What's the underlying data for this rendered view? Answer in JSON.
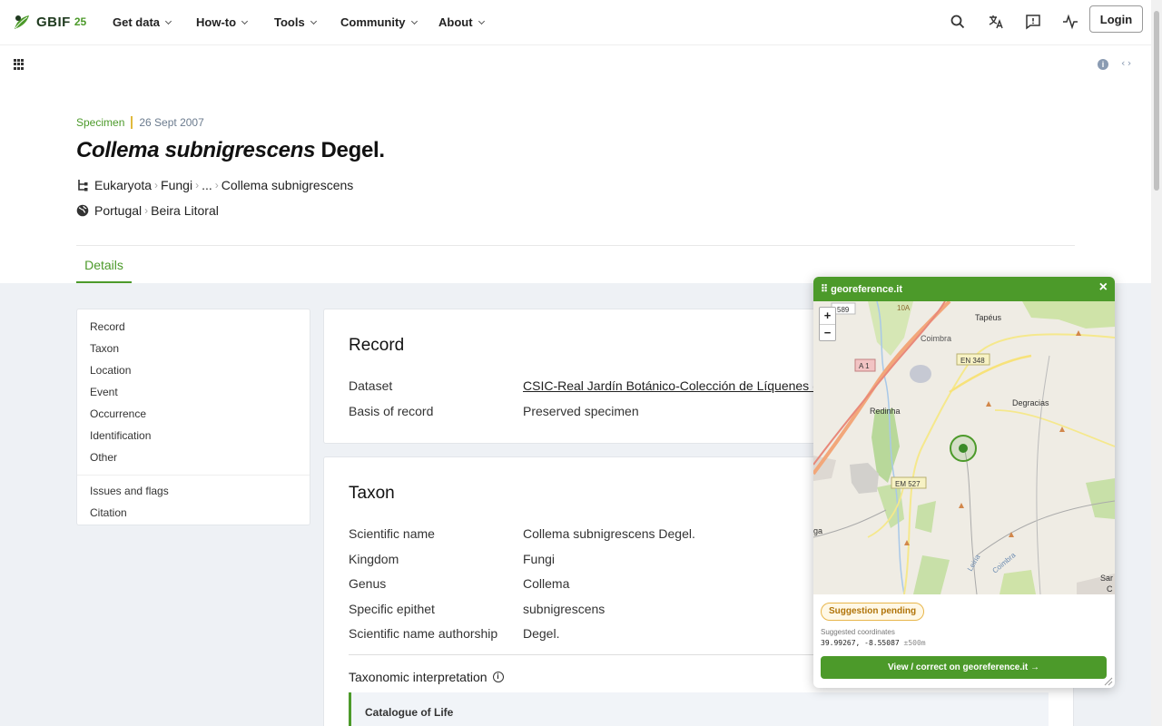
{
  "nav": {
    "logo_text": "GBIF",
    "logo_sub": "25",
    "items": [
      {
        "label": "Get data"
      },
      {
        "label": "How-to"
      },
      {
        "label": "Tools"
      },
      {
        "label": "Community"
      },
      {
        "label": "About"
      }
    ],
    "icons": [
      "search-icon",
      "translate-icon",
      "feedback-icon",
      "activity-icon"
    ],
    "login_label": "Login"
  },
  "toolbar": {
    "info_glyph": "i",
    "code_glyph": "‹›"
  },
  "record": {
    "type": "Specimen",
    "date": "26 Sept 2007",
    "title_italic": "Collema subnigrescens",
    "title_author": "Degel.",
    "taxonomy": [
      "Eukaryota",
      "Fungi",
      "...",
      "Collema subnigrescens"
    ],
    "location": [
      "Portugal",
      "Beira Litoral"
    ]
  },
  "tabs": {
    "details": "Details"
  },
  "sidebar": {
    "items": [
      "Record",
      "Taxon",
      "Location",
      "Event",
      "Occurrence",
      "Identification",
      "Other"
    ],
    "extra": [
      "Issues and flags",
      "Citation"
    ]
  },
  "record_card": {
    "title": "Record",
    "rows": [
      {
        "label": "Dataset",
        "value": "CSIC-Real Jardín Botánico-Colección de Líquenes (MA-Lichen)"
      },
      {
        "label": "Basis of record",
        "value": "Preserved specimen"
      }
    ]
  },
  "taxon_card": {
    "title": "Taxon",
    "rows": [
      {
        "label": "Scientific name",
        "value": "Collema subnigrescens Degel."
      },
      {
        "label": "Kingdom",
        "value": "Fungi"
      },
      {
        "label": "Genus",
        "value": "Collema"
      },
      {
        "label": "Specific epithet",
        "value": "subnigrescens"
      },
      {
        "label": "Scientific name authorship",
        "value": "Degel."
      }
    ],
    "interp_label": "Taxonomic interpretation",
    "info_glyph": "i",
    "col_label": "Catalogue of Life"
  },
  "popup": {
    "title": "⠿ georeference.it",
    "close": "×",
    "zoom_in": "+",
    "zoom_out": "−",
    "map_labels": {
      "r589": "589",
      "r10a": "10A",
      "coimbra1": "Coimbra",
      "tapeus": "Tapéus",
      "en348": "EN 348",
      "a1": "A 1",
      "degracias": "Degracias",
      "redinha": "Redinha",
      "em527": "EM 527",
      "ga": "ga",
      "leiria": "Leiria",
      "coimbra2": "Coimbra",
      "sar": "Sar",
      "c": "C"
    },
    "status": "Suggestion pending",
    "coords_label": "Suggested coordinates",
    "coords": "39.99267, -8.55087",
    "accuracy": "±500m",
    "button": "View / correct on georeference.it →"
  },
  "colors": {
    "brand": "#4c9a2a",
    "kicker_bar": "#e0b93c",
    "badge_border": "#e8b64b"
  }
}
